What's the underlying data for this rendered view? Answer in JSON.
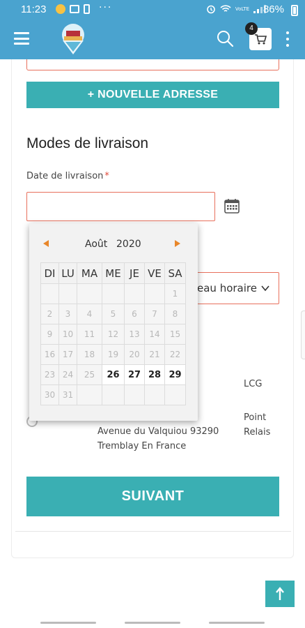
{
  "status_bar": {
    "time": "11:23",
    "more": "···",
    "battery": "86%",
    "network": "VoLTE"
  },
  "app_bar": {
    "cart_count": "4"
  },
  "form": {
    "new_address_label": "+ NOUVELLE ADRESSE",
    "section_title": "Modes de livraison",
    "date_label": "Date de livraison",
    "required_mark": "*",
    "date_value": "",
    "slot_placeholder": "eau horaire",
    "carriers": [
      {
        "name": "LCG"
      },
      {
        "name": "Point Relais",
        "address_line1": "Avenue du Valquiou 93290",
        "address_line2": "Tremblay En France"
      }
    ],
    "next_label": "SUIVANT"
  },
  "calendar": {
    "month": "Août",
    "year": "2020",
    "weekdays": [
      "DI",
      "LU",
      "MA",
      "ME",
      "JE",
      "VE",
      "SA"
    ],
    "weeks": [
      [
        "",
        "",
        "",
        "",
        "",
        "",
        "1"
      ],
      [
        "2",
        "3",
        "4",
        "5",
        "6",
        "7",
        "8"
      ],
      [
        "9",
        "10",
        "11",
        "12",
        "13",
        "14",
        "15"
      ],
      [
        "16",
        "17",
        "18",
        "19",
        "20",
        "21",
        "22"
      ],
      [
        "23",
        "24",
        "25",
        "26",
        "27",
        "28",
        "29"
      ],
      [
        "30",
        "31",
        "",
        "",
        "",
        "",
        ""
      ]
    ],
    "selectable_days": [
      "26",
      "27",
      "28",
      "29"
    ]
  },
  "colors": {
    "primary": "#4aa3cf",
    "button": "#3aafb3",
    "error_border": "#e8705c",
    "arrow": "#e8872a"
  },
  "icons": [
    "menu-icon",
    "search-icon",
    "cart-icon",
    "more-vertical-icon",
    "calendar-icon",
    "chevron-down-icon",
    "arrow-up-icon"
  ]
}
